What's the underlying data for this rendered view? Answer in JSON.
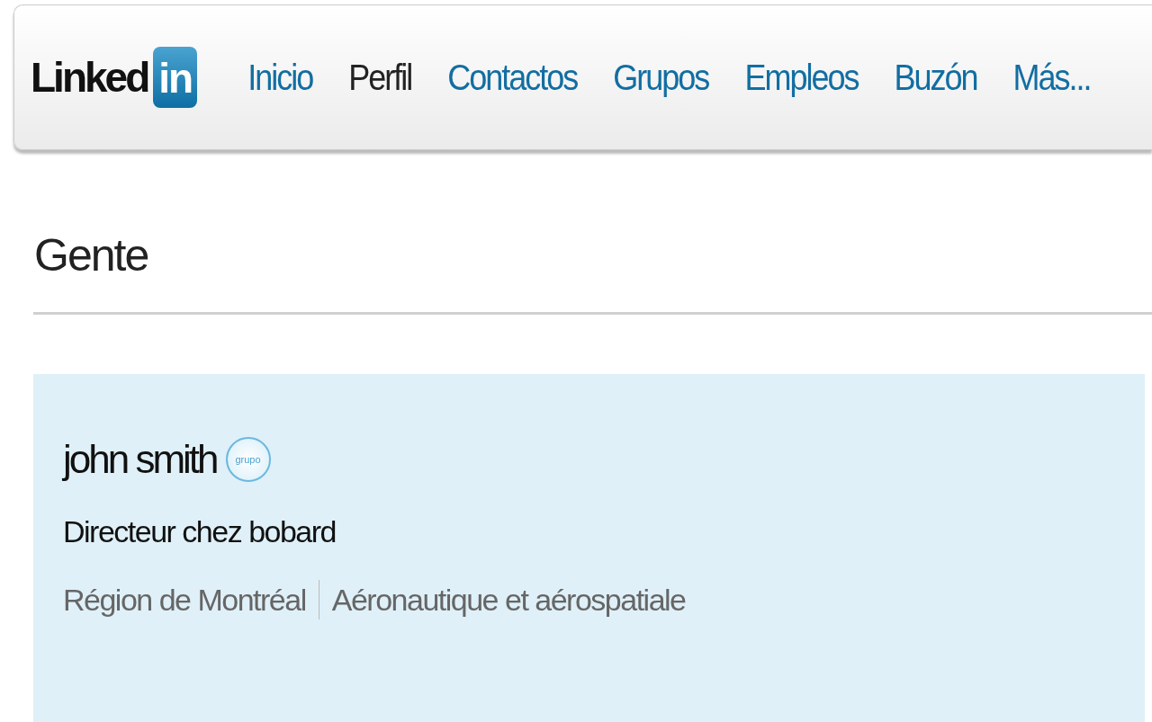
{
  "logo": {
    "word": "Linked",
    "badge": "in"
  },
  "nav": [
    {
      "label": "Inicio",
      "selected": false
    },
    {
      "label": "Perfil",
      "selected": true
    },
    {
      "label": "Contactos",
      "selected": false
    },
    {
      "label": "Grupos",
      "selected": false
    },
    {
      "label": "Empleos",
      "selected": false
    },
    {
      "label": "Buzón",
      "selected": false
    },
    {
      "label": "Más...",
      "selected": false
    }
  ],
  "section_title": "Gente",
  "result": {
    "name": "john smith",
    "badge": "grupo",
    "headline": "Directeur chez bobard",
    "location": "Région de Montréal",
    "industry": "Aéronautique et aérospatiale"
  }
}
